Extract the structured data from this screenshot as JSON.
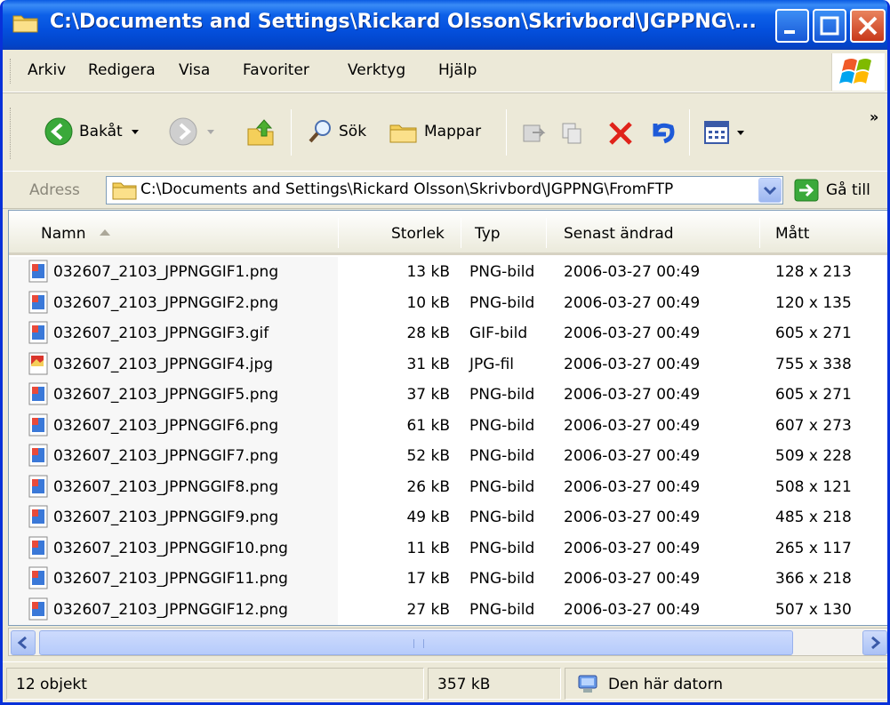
{
  "window": {
    "title": "C:\\Documents and Settings\\Rickard Olsson\\Skrivbord\\JGPPNG\\..."
  },
  "menu": [
    "Arkiv",
    "Redigera",
    "Visa",
    "Favoriter",
    "Verktyg",
    "Hjälp"
  ],
  "toolbar": {
    "back_label": "Bakåt",
    "search_label": "Sök",
    "folders_label": "Mappar"
  },
  "address": {
    "label": "Adress",
    "path": "C:\\Documents and Settings\\Rickard Olsson\\Skrivbord\\JGPPNG\\FromFTP",
    "go_label": "Gå till"
  },
  "columns": {
    "name": "Namn",
    "size": "Storlek",
    "type": "Typ",
    "modified": "Senast ändrad",
    "dimensions": "Mått"
  },
  "files": [
    {
      "name": "032607_2103_JPPNGGIF1.png",
      "size": "13 kB",
      "type": "PNG-bild",
      "modified": "2006-03-27 00:49",
      "dimensions": "128 x 213",
      "icon": "png-file-icon"
    },
    {
      "name": "032607_2103_JPPNGGIF2.png",
      "size": "10 kB",
      "type": "PNG-bild",
      "modified": "2006-03-27 00:49",
      "dimensions": "120 x 135",
      "icon": "png-file-icon"
    },
    {
      "name": "032607_2103_JPPNGGIF3.gif",
      "size": "28 kB",
      "type": "GIF-bild",
      "modified": "2006-03-27 00:49",
      "dimensions": "605 x 271",
      "icon": "gif-file-icon"
    },
    {
      "name": "032607_2103_JPPNGGIF4.jpg",
      "size": "31 kB",
      "type": "JPG-fil",
      "modified": "2006-03-27 00:49",
      "dimensions": "755 x 338",
      "icon": "jpg-file-icon"
    },
    {
      "name": "032607_2103_JPPNGGIF5.png",
      "size": "37 kB",
      "type": "PNG-bild",
      "modified": "2006-03-27 00:49",
      "dimensions": "605 x 271",
      "icon": "png-file-icon"
    },
    {
      "name": "032607_2103_JPPNGGIF6.png",
      "size": "61 kB",
      "type": "PNG-bild",
      "modified": "2006-03-27 00:49",
      "dimensions": "607 x 273",
      "icon": "png-file-icon"
    },
    {
      "name": "032607_2103_JPPNGGIF7.png",
      "size": "52 kB",
      "type": "PNG-bild",
      "modified": "2006-03-27 00:49",
      "dimensions": "509 x 228",
      "icon": "png-file-icon"
    },
    {
      "name": "032607_2103_JPPNGGIF8.png",
      "size": "26 kB",
      "type": "PNG-bild",
      "modified": "2006-03-27 00:49",
      "dimensions": "508 x 121",
      "icon": "png-file-icon"
    },
    {
      "name": "032607_2103_JPPNGGIF9.png",
      "size": "49 kB",
      "type": "PNG-bild",
      "modified": "2006-03-27 00:49",
      "dimensions": "485 x 218",
      "icon": "png-file-icon"
    },
    {
      "name": "032607_2103_JPPNGGIF10.png",
      "size": "11 kB",
      "type": "PNG-bild",
      "modified": "2006-03-27 00:49",
      "dimensions": "265 x 117",
      "icon": "png-file-icon"
    },
    {
      "name": "032607_2103_JPPNGGIF11.png",
      "size": "17 kB",
      "type": "PNG-bild",
      "modified": "2006-03-27 00:49",
      "dimensions": "366 x 218",
      "icon": "png-file-icon"
    },
    {
      "name": "032607_2103_JPPNGGIF12.png",
      "size": "27 kB",
      "type": "PNG-bild",
      "modified": "2006-03-27 00:49",
      "dimensions": "507 x 130",
      "icon": "png-file-icon"
    }
  ],
  "status": {
    "count": "12 objekt",
    "total_size": "357 kB",
    "zone": "Den här datorn"
  },
  "colors": {
    "titlebar": "#0450dd",
    "close_button": "#c8391a",
    "chrome": "#ece9d8"
  }
}
